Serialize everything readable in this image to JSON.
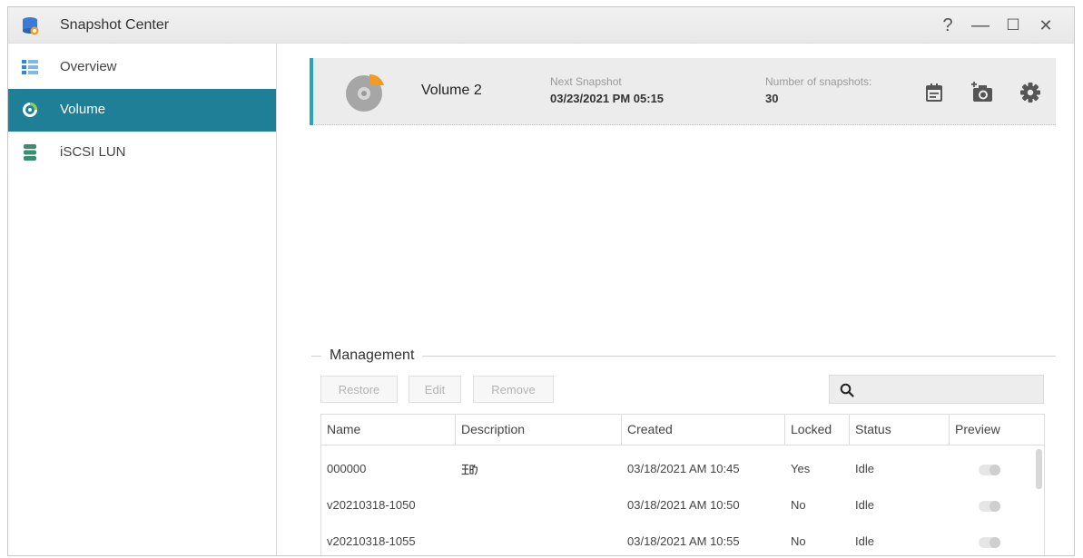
{
  "window": {
    "title": "Snapshot Center",
    "controls": {
      "help": "?",
      "minimize": "—",
      "maximize": "☐",
      "close": "✕"
    }
  },
  "sidebar": {
    "items": [
      {
        "label": "Overview",
        "icon": "overview-icon"
      },
      {
        "label": "Volume",
        "icon": "volume-icon",
        "active": true
      },
      {
        "label": "iSCSI LUN",
        "icon": "iscsi-lun-icon"
      }
    ]
  },
  "volume_card": {
    "name": "Volume 2",
    "next_snapshot_label": "Next Snapshot",
    "next_snapshot_value": "03/23/2021 PM 05:15",
    "num_snapshots_label": "Number of snapshots:",
    "num_snapshots_value": "30",
    "accent_color": "#2aa3bd",
    "buttons": [
      "schedule-icon",
      "take-snapshot-icon",
      "settings-icon"
    ]
  },
  "management": {
    "title": "Management",
    "toolbar": {
      "restore": "Restore",
      "edit": "Edit",
      "remove": "Remove"
    },
    "search": {
      "placeholder": ""
    },
    "columns": [
      "Name",
      "Description",
      "Created",
      "Locked",
      "Status",
      "Preview"
    ],
    "rows": [
      {
        "name": "000000",
        "description": "",
        "created": "03/18/2021 AM 10:45",
        "locked": "Yes",
        "status": "Idle"
      },
      {
        "name": "v20210318-1050",
        "description": "",
        "created": "03/18/2021 AM 10:50",
        "locked": "No",
        "status": "Idle"
      },
      {
        "name": "v20210318-1055",
        "description": "",
        "created": "03/18/2021 AM 10:55",
        "locked": "No",
        "status": "Idle"
      }
    ]
  },
  "colors": {
    "active_sidebar": "#1f7f96"
  }
}
